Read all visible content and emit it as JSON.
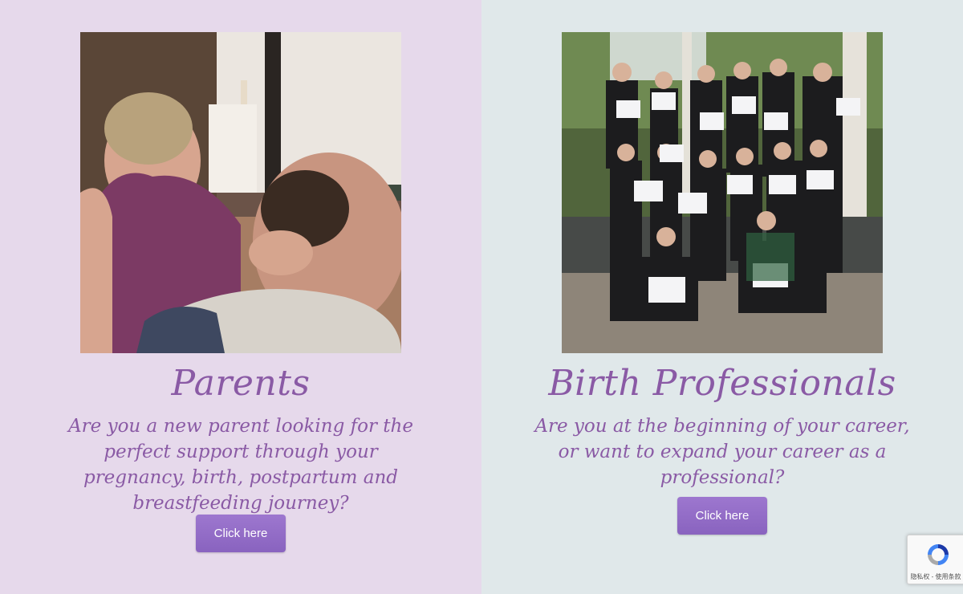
{
  "parents": {
    "title": "Parents",
    "description": "Are you a new parent looking for the perfect support through your pregnancy, birth, postpartum and breastfeeding journey?",
    "button_label": "Click here"
  },
  "professionals": {
    "title": "Birth Professionals",
    "description": "Are you at the beginning of your career, or want to expand your career as a professional?",
    "button_label": "Click here"
  },
  "recaptcha": {
    "icon": "recaptcha-icon",
    "terms": "隐私权 - 使用条款"
  },
  "colors": {
    "left_background": "#e6d9eb",
    "right_background": "#e0e8ea",
    "accent": "#8a5aa5",
    "button": "#9270c6"
  }
}
